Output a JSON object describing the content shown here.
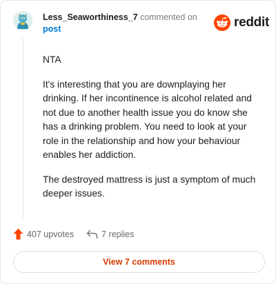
{
  "comment": {
    "username": "Less_Seaworthiness_7",
    "action_text": "commented on",
    "target_text": "post",
    "paragraphs": [
      "NTA",
      "It's interesting that you are downplaying her drinking. If her incontinence is alcohol related and not due to another health issue you do know she has a drinking problem. You need to look at your role in the relationship and how your behaviour enables her addiction.",
      "The destroyed mattress is just a symptom of much deeper issues."
    ]
  },
  "brand": {
    "name": "reddit",
    "color": "#ff4500"
  },
  "actions": {
    "upvotes_label": "407 upvotes",
    "replies_label": "7 replies"
  },
  "view_button_label": "View 7 comments",
  "colors": {
    "accent": "#d93a00",
    "link": "#0079d3",
    "upvote": "#ff4500"
  }
}
